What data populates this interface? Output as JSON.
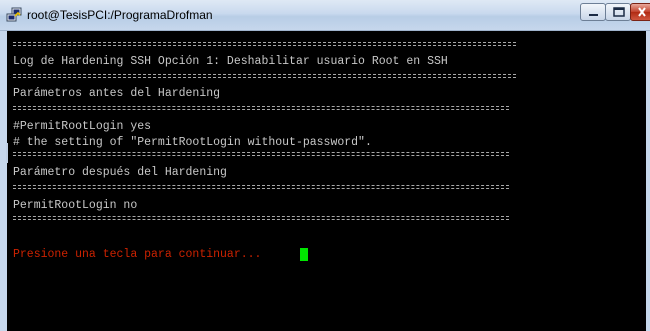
{
  "window": {
    "title": "root@TesisPCI:/ProgramaDrofman",
    "minimize_icon": "minimize-icon",
    "maximize_icon": "maximize-icon",
    "close_icon": "close-icon",
    "app_icon": "putty-icon"
  },
  "terminal": {
    "header": "Log de Hardening SSH Opción 1: Deshabilitar usuario Root en SSH",
    "before_title": "Parámetros antes del Hardening",
    "before_line1": "#PermitRootLogin yes",
    "before_line2": "# the setting of \"PermitRootLogin without-password\".",
    "after_title": "Parámetro después del Hardening",
    "after_line1": "PermitRootLogin no",
    "prompt": "Presione una tecla para continuar...",
    "text_color": "#c8c8c8",
    "prompt_color": "#cc2200",
    "cursor_color": "#00e600"
  }
}
